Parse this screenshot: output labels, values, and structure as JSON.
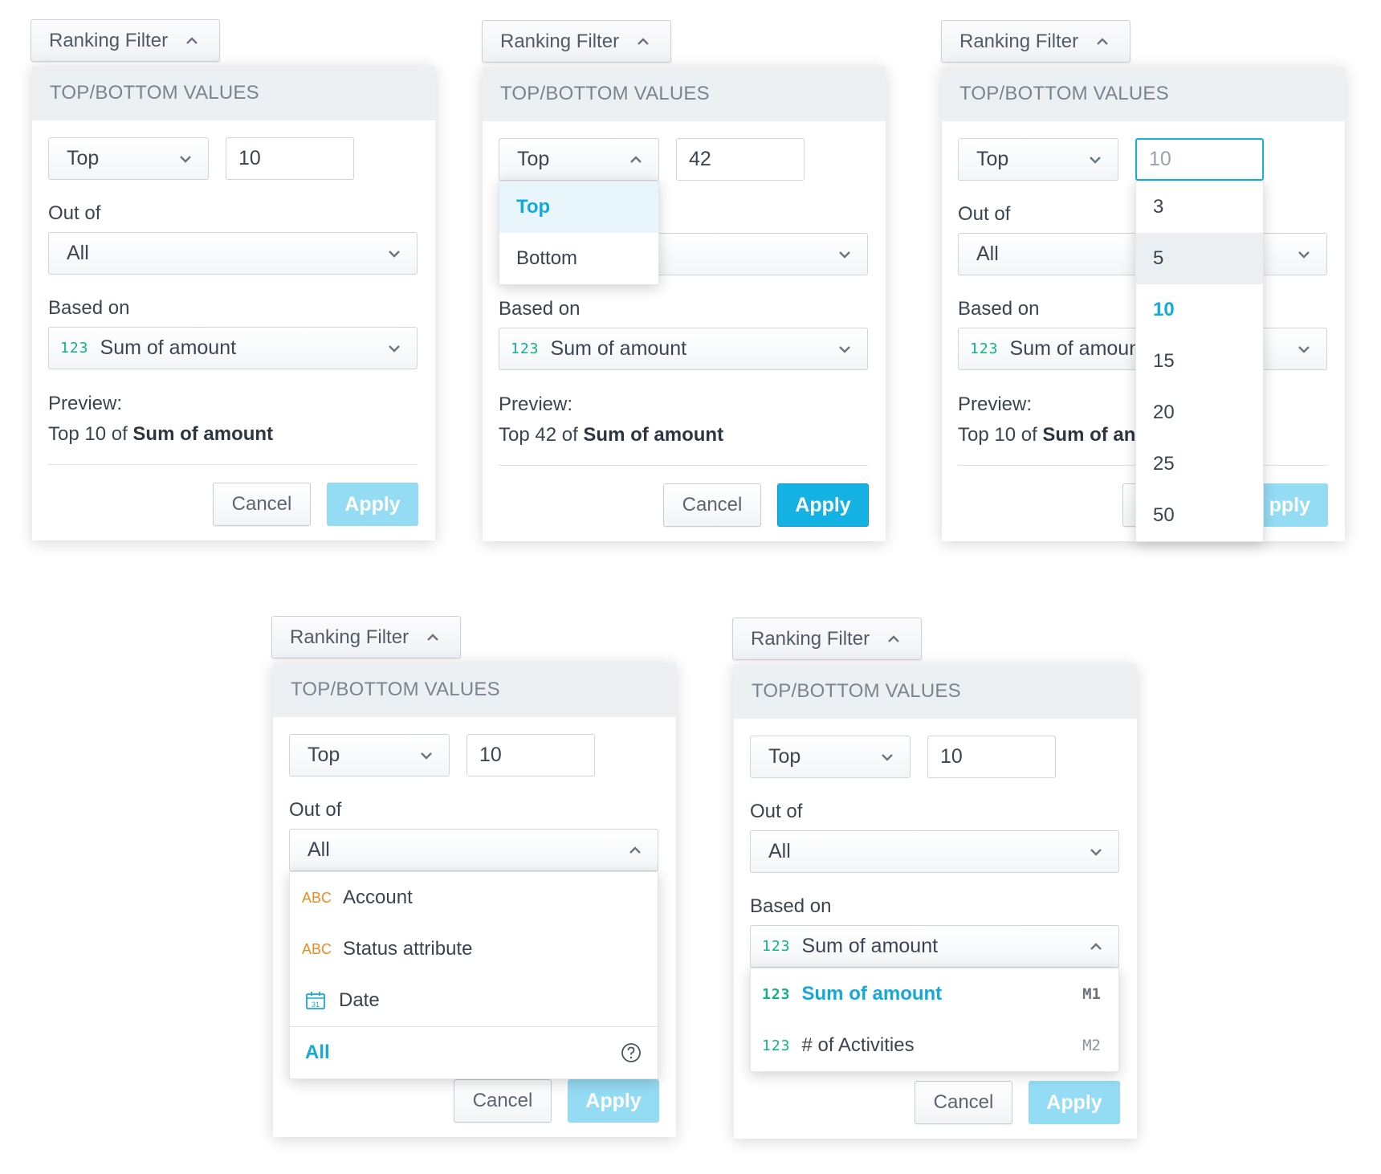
{
  "ranking_filter_label": "Ranking Filter",
  "header": "TOP/BOTTOM VALUES",
  "out_of_label": "Out of",
  "based_on_label": "Based on",
  "preview_label": "Preview:",
  "cancel_label": "Cancel",
  "apply_label": "Apply",
  "tags": {
    "numeric": "123",
    "text": "ABC",
    "calendar_day": "31"
  },
  "panel1": {
    "direction": "Top",
    "count": "10",
    "out_of": "All",
    "based_on": "Sum of amount",
    "preview_prefix": "Top 10 of",
    "preview_metric": "Sum of amount"
  },
  "panel2": {
    "direction": "Top",
    "count": "42",
    "based_on": "Sum of amount",
    "preview_prefix": "Top 42 of",
    "preview_metric": "Sum of amount",
    "direction_options": [
      "Top",
      "Bottom"
    ]
  },
  "panel3": {
    "direction": "Top",
    "count_placeholder": "10",
    "out_of": "All",
    "based_on": "Sum of amoun",
    "preview_prefix": "Top 10 of",
    "preview_metric": "Sum of an",
    "apply_partial": "pply",
    "count_options": [
      "3",
      "5",
      "10",
      "15",
      "20",
      "25",
      "50"
    ]
  },
  "panel4": {
    "direction": "Top",
    "count": "10",
    "out_of": "All",
    "out_of_options": [
      {
        "type": "ABC",
        "label": "Account"
      },
      {
        "type": "ABC",
        "label": "Status attribute"
      },
      {
        "type": "date",
        "label": "Date"
      }
    ],
    "all_option": "All"
  },
  "panel5": {
    "direction": "Top",
    "count": "10",
    "out_of": "All",
    "based_on": "Sum of amount",
    "based_on_options": [
      {
        "label": "Sum of amount",
        "key": "M1"
      },
      {
        "label": "# of Activities",
        "key": "M2"
      }
    ]
  }
}
